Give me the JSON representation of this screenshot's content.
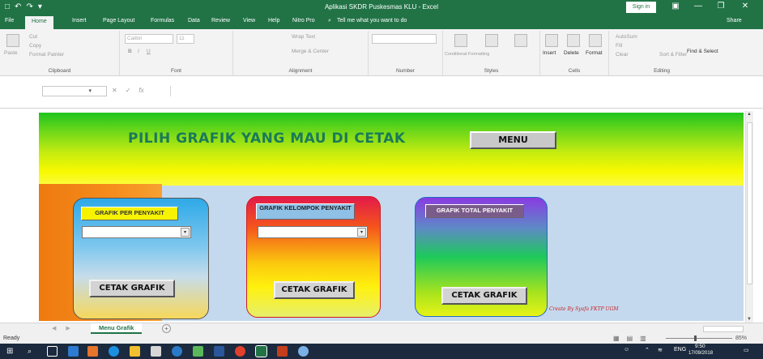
{
  "window": {
    "title": "Aplikasi SKDR Puskesmas KLU  -  Excel",
    "sign_in": "Sign in",
    "quick_access": [
      "□",
      "↶",
      "↷",
      "▾"
    ],
    "win_controls": [
      "▣",
      "—",
      "❐",
      "✕"
    ]
  },
  "ribbon_tabs": [
    "File",
    "Home",
    "Insert",
    "Page Layout",
    "Formulas",
    "Data",
    "Review",
    "View",
    "Help",
    "Nitro Pro"
  ],
  "tell_me": "Tell me what you want to do",
  "share": "Share",
  "ribbon": {
    "clipboard": {
      "label": "Clipboard",
      "paste": "Paste",
      "cut": "Cut",
      "copy": "Copy",
      "format_painter": "Format Painter"
    },
    "font": {
      "label": "Font",
      "name": "Calibri",
      "size": "11",
      "bold": "B",
      "italic": "I",
      "underline": "U"
    },
    "alignment": {
      "label": "Alignment",
      "wrap": "Wrap Text",
      "merge": "Merge & Center"
    },
    "number": {
      "label": "Number"
    },
    "styles": {
      "label": "Styles",
      "conditional": "Conditional Formatting",
      "format_table": "Format as Table",
      "cell_styles": "Cell Styles"
    },
    "cells": {
      "label": "Cells",
      "insert": "Insert",
      "delete": "Delete",
      "format": "Format"
    },
    "editing": {
      "label": "Editing",
      "autosum": "AutoSum",
      "fill": "Fill",
      "clear": "Clear",
      "sort": "Sort & Filter",
      "find": "Find & Select"
    }
  },
  "formula_bar": {
    "fx": "fx",
    "cancel": "✕",
    "enter": "✓"
  },
  "sheet": {
    "banner_title": "PILIH GRAFIK YANG MAU DI CETAK",
    "menu_button": "MENU",
    "panels": [
      {
        "header": "GRAFIK PER PENYAKIT",
        "action": "CETAK GRAFIK",
        "has_combo": true
      },
      {
        "header": "GRAFIK  KELOMPOK PENYAKIT",
        "action": "CETAK GRAFIK",
        "has_combo": true
      },
      {
        "header": "GRAFIK  TOTAL PENYAKIT",
        "action": "CETAK GRAFIK",
        "has_combo": false
      }
    ],
    "credit": "Create By Syafa FKTP UGM"
  },
  "sheet_tabs": {
    "active": "Menu Grafik",
    "add": "+"
  },
  "status": {
    "ready": "Ready",
    "zoom": "85%"
  },
  "taskbar": {
    "lang": "ENG",
    "time": "9:50",
    "date": "17/09/2018"
  },
  "colors": {
    "excel_green": "#217346",
    "banner_top": "#1ec41e",
    "banner_bottom": "#fbfb40",
    "sheet_bg": "#c5d9ee",
    "credit_red": "#c62020"
  }
}
